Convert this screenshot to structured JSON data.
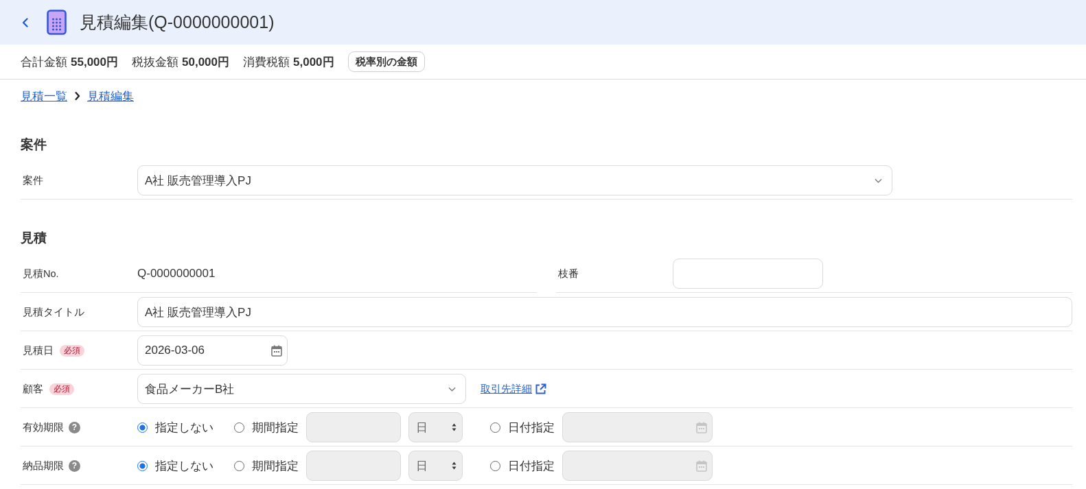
{
  "header": {
    "title": "見積編集(Q-0000000001)"
  },
  "summary": {
    "items": [
      {
        "label": "合計金額",
        "value": "55,000円"
      },
      {
        "label": "税抜金額",
        "value": "50,000円"
      },
      {
        "label": "消費税額",
        "value": "5,000円"
      }
    ],
    "button": "税率別の金額"
  },
  "breadcrumb": [
    {
      "label": "見積一覧"
    },
    {
      "label": "見積編集"
    }
  ],
  "sections": [
    {
      "title": "案件",
      "rows": [
        {
          "kind": "select",
          "label": "案件",
          "value": "A社 販売管理導入PJ"
        }
      ]
    },
    {
      "title": "見積",
      "rows": [
        {
          "kind": "pair",
          "columns": [
            {
              "kind": "static",
              "label": "見積No.",
              "value": "Q-0000000001"
            },
            {
              "kind": "input",
              "label": "枝番"
            }
          ]
        },
        {
          "kind": "input",
          "label": "見積タイトル",
          "value": "A社 販売管理導入PJ"
        },
        {
          "kind": "date",
          "label": "見積日",
          "badge": "必須",
          "value": "2026-03-06"
        },
        {
          "kind": "select",
          "label": "顧客",
          "badge": "必須",
          "value": "食品メーカーB社",
          "link": "取引先詳細"
        },
        {
          "kind": "deadline",
          "label": "有効期限",
          "help": "?",
          "options": [
            {
              "label": "指定しない",
              "selected": true
            },
            {
              "label": "期間指定",
              "selected": false,
              "fields": [
                {
                  "kind": "number",
                  "disabled": true
                },
                {
                  "kind": "unit",
                  "value": "日",
                  "disabled": true
                }
              ]
            },
            {
              "label": "日付指定",
              "selected": false,
              "fields": [
                {
                  "kind": "date",
                  "disabled": true
                }
              ]
            }
          ]
        },
        {
          "kind": "deadline",
          "label": "納品期限",
          "help": "?",
          "options": [
            {
              "label": "指定しない",
              "selected": true
            },
            {
              "label": "期間指定",
              "selected": false,
              "fields": [
                {
                  "kind": "number",
                  "disabled": true
                },
                {
                  "kind": "unit",
                  "value": "日",
                  "disabled": true
                }
              ]
            },
            {
              "label": "日付指定",
              "selected": false,
              "fields": [
                {
                  "kind": "date",
                  "disabled": true
                }
              ]
            }
          ]
        }
      ]
    }
  ]
}
